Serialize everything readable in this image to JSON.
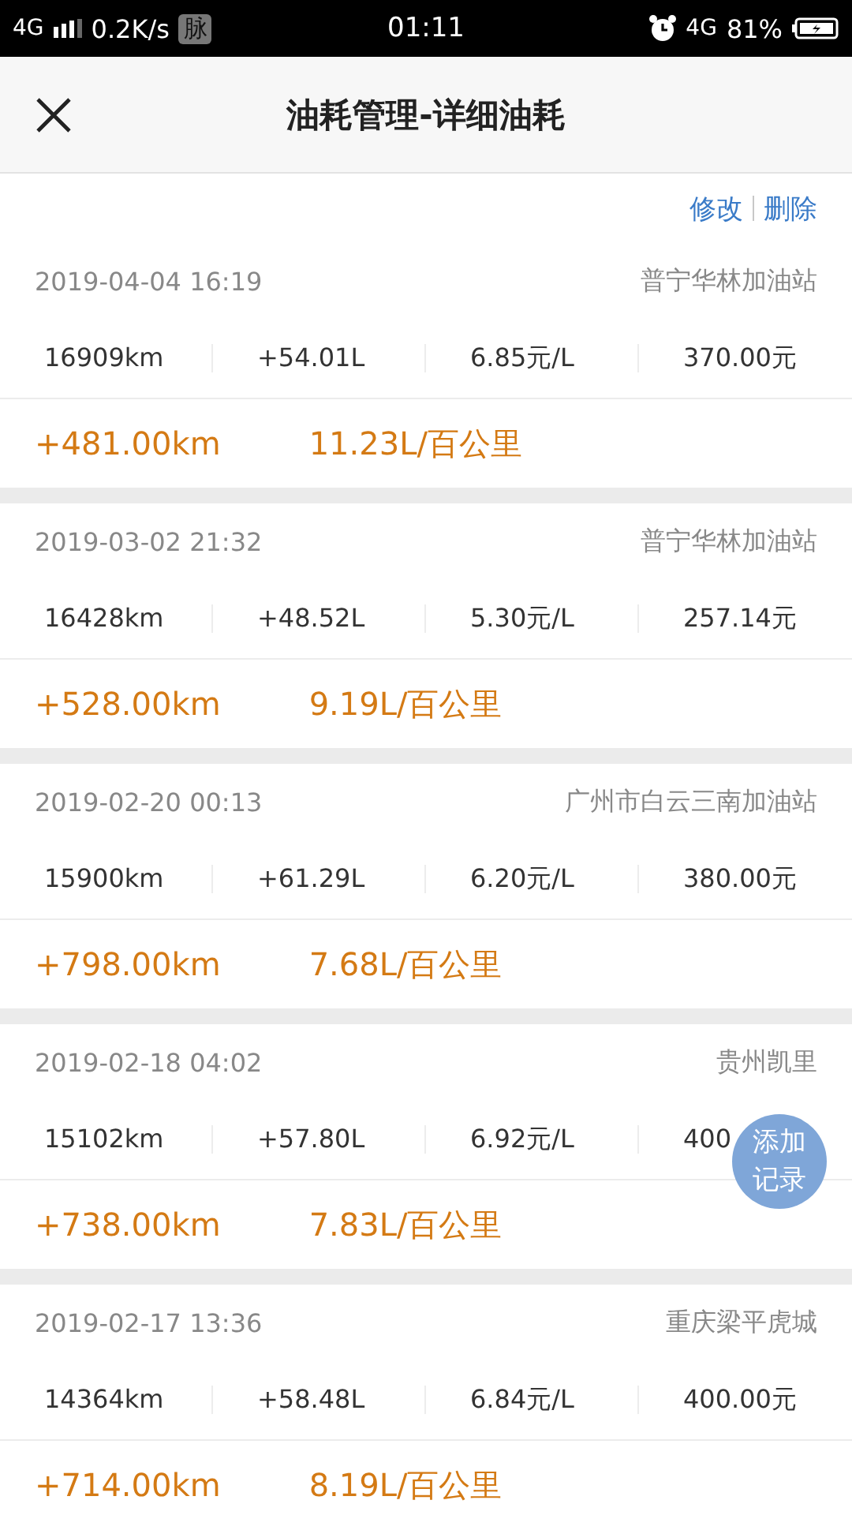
{
  "status_bar": {
    "network": "4G",
    "speed": "0.2K/s",
    "app_badge": "脉",
    "time": "01:11",
    "network_right": "4G",
    "battery": "81%"
  },
  "header": {
    "title": "油耗管理-详细油耗"
  },
  "actions": [
    {
      "label": "修改"
    },
    {
      "label": "删除"
    }
  ],
  "records": [
    {
      "datetime": "2019-04-04 16:19",
      "station": "普宁华林加油站",
      "odometer": "16909km",
      "fuel": "+54.01L",
      "unit_price": "6.85元/L",
      "cost": "370.00元",
      "distance": "+481.00km",
      "consumption": "11.23L/百公里"
    },
    {
      "datetime": "2019-03-02 21:32",
      "station": "普宁华林加油站",
      "odometer": "16428km",
      "fuel": "+48.52L",
      "unit_price": "5.30元/L",
      "cost": "257.14元",
      "distance": "+528.00km",
      "consumption": "9.19L/百公里"
    },
    {
      "datetime": "2019-02-20 00:13",
      "station": "广州市白云三南加油站",
      "odometer": "15900km",
      "fuel": "+61.29L",
      "unit_price": "6.20元/L",
      "cost": "380.00元",
      "distance": "+798.00km",
      "consumption": "7.68L/百公里"
    },
    {
      "datetime": "2019-02-18 04:02",
      "station": "贵州凯里",
      "odometer": "15102km",
      "fuel": "+57.80L",
      "unit_price": "6.92元/L",
      "cost": "400",
      "distance": "+738.00km",
      "consumption": "7.83L/百公里"
    },
    {
      "datetime": "2019-02-17 13:36",
      "station": "重庆梁平虎城",
      "odometer": "14364km",
      "fuel": "+58.48L",
      "unit_price": "6.84元/L",
      "cost": "400.00元",
      "distance": "+714.00km",
      "consumption": "8.19L/百公里"
    }
  ],
  "fab": {
    "label_lines": [
      "添加",
      "记录"
    ]
  }
}
